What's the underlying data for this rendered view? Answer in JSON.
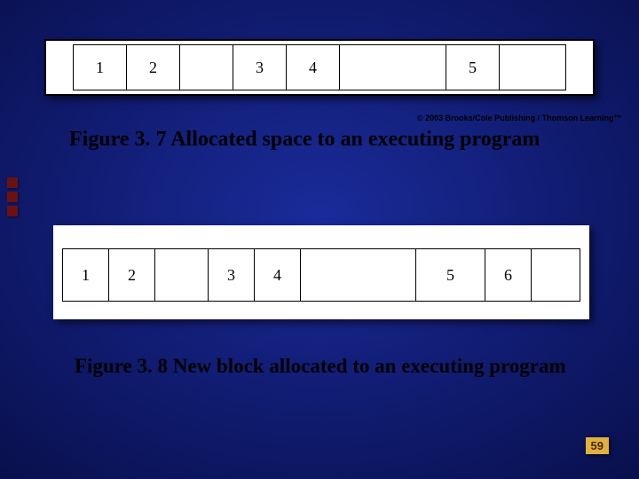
{
  "copyright": "© 2003 Brooks/Cole Publishing / Thomson Learning™",
  "figure1": {
    "label_prefix": "Figure 3. 7",
    "caption_rest": "  Allocated space to an executing program",
    "blocks": [
      {
        "label": "1",
        "width": 60
      },
      {
        "label": "2",
        "width": 60
      },
      {
        "label": "",
        "width": 60
      },
      {
        "label": "3",
        "width": 60
      },
      {
        "label": "4",
        "width": 60
      },
      {
        "label": "",
        "width": 120
      },
      {
        "label": "5",
        "width": 60
      },
      {
        "label": "",
        "width": 80
      }
    ]
  },
  "figure2": {
    "label_prefix": "Figure 3. 8",
    "caption_rest": "  New block allocated to an executing program",
    "blocks": [
      {
        "label": "1",
        "width": 52
      },
      {
        "label": "2",
        "width": 52
      },
      {
        "label": "",
        "width": 60
      },
      {
        "label": "3",
        "width": 52
      },
      {
        "label": "4",
        "width": 52
      },
      {
        "label": "",
        "width": 130
      },
      {
        "label": "5",
        "width": 78
      },
      {
        "label": "6",
        "width": 52
      },
      {
        "label": "",
        "width": 56
      }
    ]
  },
  "page_number": "59"
}
